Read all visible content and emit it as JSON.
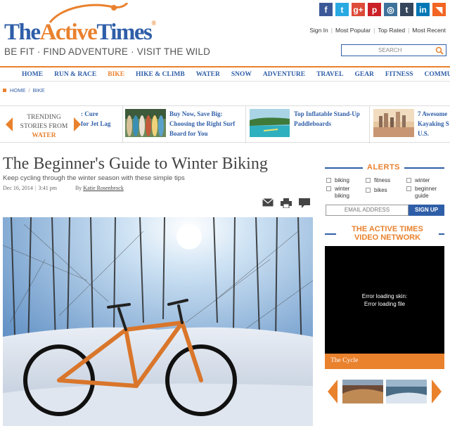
{
  "header": {
    "logo_prefix": "The",
    "logo_active": "Active",
    "logo_times": "Times",
    "logo_reg": "®",
    "tagline": "BE FIT · FIND ADVENTURE · VISIT THE WILD",
    "social": [
      {
        "icon": "facebook-icon",
        "glyph": "f",
        "color": "#3b5998"
      },
      {
        "icon": "twitter-icon",
        "glyph": "t",
        "color": "#29a9e1"
      },
      {
        "icon": "google-plus-icon",
        "glyph": "g+",
        "color": "#dd4b39"
      },
      {
        "icon": "pinterest-icon",
        "glyph": "p",
        "color": "#cb2027"
      },
      {
        "icon": "instagram-icon",
        "glyph": "◎",
        "color": "#3f729b"
      },
      {
        "icon": "tumblr-icon",
        "glyph": "t",
        "color": "#35465c"
      },
      {
        "icon": "linkedin-icon",
        "glyph": "in",
        "color": "#0077b5"
      },
      {
        "icon": "rss-icon",
        "glyph": "◥",
        "color": "#f26522"
      }
    ],
    "links": [
      "Sign In",
      "Most Popular",
      "Top Rated",
      "Most Recent"
    ],
    "link_sep": "|",
    "search_placeholder": "SEARCH"
  },
  "nav": {
    "items": [
      "HOME",
      "RUN & RACE",
      "BIKE",
      "HIKE & CLIMB",
      "WATER",
      "SNOW",
      "ADVENTURE",
      "TRAVEL",
      "GEAR",
      "FITNESS",
      "COMMUNITY"
    ],
    "active": "BIKE"
  },
  "breadcrumb": [
    "HOME",
    "BIKE"
  ],
  "breadcrumb_sep": "/",
  "trending": {
    "label_line1": "TRENDING",
    "label_line2": "STORIES FROM",
    "label_topic": "WATER",
    "items": [
      {
        "line1": ": Cure",
        "line2": "for Jet Lag"
      },
      {
        "line1": "Buy Now, Save Big:",
        "line2": "Choosing the Right Surf",
        "line3": "Board for You"
      },
      {
        "line1": "Top Inflatable Stand-Up",
        "line2": "Paddleboards"
      },
      {
        "line1": "7 Awesome",
        "line2": "Kayaking S",
        "line3": "U.S."
      }
    ]
  },
  "article": {
    "title": "The Beginner's Guide to Winter Biking",
    "subtitle": "Keep cycling through the winter season with these simple tips",
    "date": "Dec 16, 2014",
    "time": "3:41 pm",
    "meta_sep": "|",
    "byline": "By",
    "author": "Katie Rosenbrock"
  },
  "alerts": {
    "title": "ALERTS",
    "options": [
      "biking",
      "fitness",
      "winter",
      "winter biking",
      "bikes",
      "beginner guide"
    ],
    "email_placeholder": "EMAIL ADDRESS",
    "signup_label": "SIGN UP"
  },
  "video": {
    "title_line1": "THE ACTIVE TIMES",
    "title_line2": "VIDEO NETWORK",
    "error_line1": "Error loading skin:",
    "error_line2": "Error loading file",
    "caption": "The Cycle"
  },
  "colors": {
    "brand_blue": "#2f5ea8",
    "brand_orange": "#e9812d"
  }
}
